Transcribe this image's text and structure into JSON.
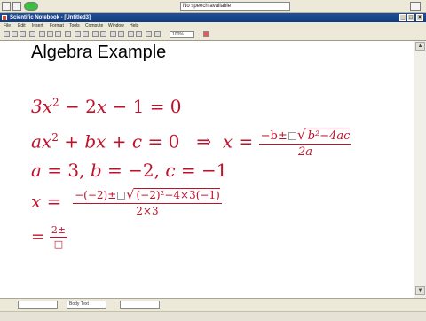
{
  "topbar": {
    "speech_status": "No speech available"
  },
  "window": {
    "title": "Scientific Notebook - [Untitled3]",
    "min_label": "_",
    "max_label": "□",
    "close_label": "×"
  },
  "menubar": {
    "items": [
      "File",
      "Edit",
      "Insert",
      "Format",
      "Tools",
      "Compute",
      "Window",
      "Help"
    ]
  },
  "toolbar": {
    "zoom_value": "100%"
  },
  "document": {
    "heading": "Algebra Example",
    "line1": "3x² − 2x − 1 = 0",
    "line2_left": "ax² + bx + c = 0",
    "arrow": "⇒",
    "x_var": "x",
    "equals": "=",
    "quadratic_num_prefix": "−b±",
    "quadratic_num_rad": "b²−4ac",
    "quadratic_den": "2a",
    "line3": "a = 3, b = −2, c = −1",
    "line4_num_prefix": "−(−2)±",
    "line4_num_rad": "(−2)²−4×3(−1)",
    "line4_den": "2×3",
    "line5_num": "2±",
    "line5_den": "□"
  },
  "statusbar": {
    "style_label": "Body Text"
  },
  "colors": {
    "math_red": "#c0112b",
    "title_blue": "#1f4f9c"
  },
  "icons": [
    "back-icon",
    "mic-icon",
    "new-icon",
    "open-icon",
    "save-icon",
    "print-icon",
    "cut-icon",
    "copy-icon",
    "paste-icon",
    "undo-icon",
    "math-text-icon"
  ]
}
